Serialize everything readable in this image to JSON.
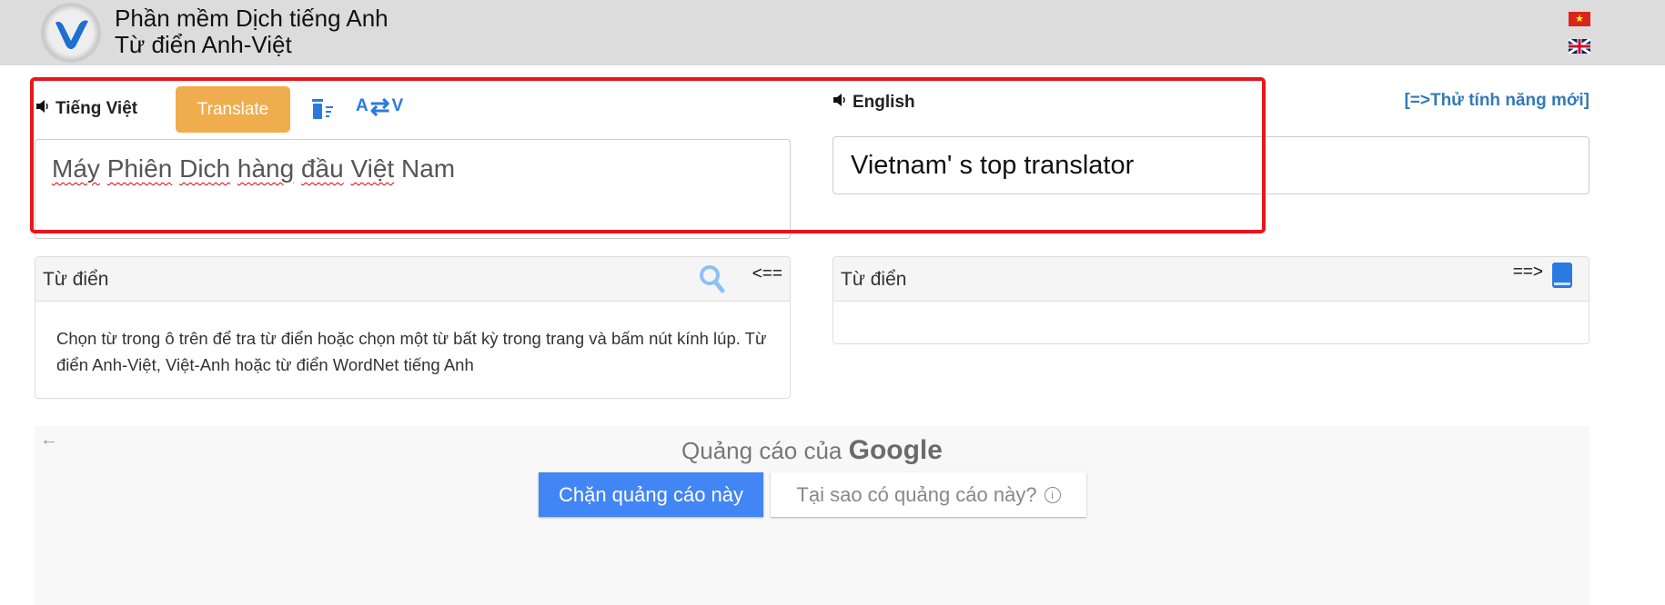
{
  "header": {
    "title_line1": "Phần mềm Dịch tiếng Anh",
    "title_line2": "Từ điển Anh-Việt",
    "logo_icon": "v-logo-icon",
    "flags": [
      "vietnam-flag-icon",
      "uk-flag-icon"
    ]
  },
  "source": {
    "language": "Tiếng Việt",
    "translate_label": "Translate",
    "swap_from": "A",
    "swap_to": "V",
    "words": [
      "Máy",
      "Phiên",
      "Dich",
      "hàng",
      "đầu",
      "Việt",
      "Nam"
    ]
  },
  "target": {
    "language": "English",
    "new_feature_link": "[=>Thử tính năng mới]",
    "text": "Vietnam' s top translator"
  },
  "dict_left": {
    "title": "Từ điển",
    "arrow": "<==",
    "body": "Chọn từ trong ô trên để tra từ điển hoặc chọn một từ bất kỳ trong trang và bấm nút kính lúp. Từ điển Anh-Việt, Việt-Anh hoặc từ điển WordNet tiếng Anh"
  },
  "dict_right": {
    "title": "Từ điển",
    "arrow": "==>"
  },
  "ad": {
    "title_prefix": "Quảng cáo của",
    "brand": "Google",
    "block_label": "Chặn quảng cáo này",
    "why_label": "Tại sao có quảng cáo này?"
  },
  "colors": {
    "accent": "#f0ad4e",
    "link": "#337ab7",
    "highlight_box": "#e8161b",
    "ad_button": "#4285f4"
  }
}
